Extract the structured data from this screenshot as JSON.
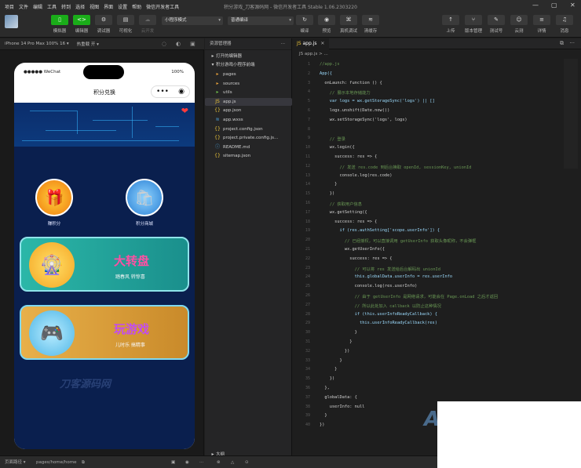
{
  "menubar": {
    "items": [
      "项目",
      "文件",
      "编辑",
      "工具",
      "转到",
      "选择",
      "视图",
      "界面",
      "设置",
      "帮助",
      "微信开发者工具"
    ],
    "title": "积分游戏_刀客源码网 - 微信开发者工具 Stable 1.06.2303220"
  },
  "toolbar": {
    "left_buttons": [
      {
        "label": "模拟器",
        "icon": "phone-icon",
        "glyph": "▯"
      },
      {
        "label": "编辑器",
        "icon": "code-icon",
        "glyph": "<>"
      },
      {
        "label": "调试器",
        "icon": "debug-icon",
        "glyph": "⚙"
      },
      {
        "label": "可视化",
        "icon": "visual-icon",
        "glyph": "▤"
      },
      {
        "label": "云开发",
        "icon": "cloud-icon",
        "glyph": "☁"
      }
    ],
    "mode_select": "小程序模式",
    "compile_select": "普通编译",
    "mid_buttons": [
      {
        "label": "编译",
        "icon": "refresh-icon",
        "glyph": "↻"
      },
      {
        "label": "预览",
        "icon": "eye-icon",
        "glyph": "◉"
      },
      {
        "label": "真机调试",
        "icon": "device-debug-icon",
        "glyph": "⌘"
      },
      {
        "label": "清缓存",
        "icon": "layers-icon",
        "glyph": "≋"
      }
    ],
    "right_buttons": [
      {
        "label": "上传",
        "icon": "upload-icon",
        "glyph": "↑"
      },
      {
        "label": "版本管理",
        "icon": "version-icon",
        "glyph": "⑂"
      },
      {
        "label": "测试号",
        "icon": "test-icon",
        "glyph": "✎"
      },
      {
        "label": "云测",
        "icon": "cloudtest-icon",
        "glyph": "☺"
      },
      {
        "label": "详情",
        "icon": "details-icon",
        "glyph": "≡"
      },
      {
        "label": "消息",
        "icon": "bell-icon",
        "glyph": "♫"
      }
    ]
  },
  "simulator": {
    "device": "iPhone 14 Pro Max 100% 16 ▾",
    "hotreload": "热重载 开 ▾",
    "status_left": "●●●●● WeChat",
    "status_right": "100%",
    "nav_title": "积分兑换",
    "icons": [
      {
        "label": "赚积分"
      },
      {
        "label": "积分商城"
      }
    ],
    "card1": {
      "title": "大转盘",
      "subtitle": "踏春风  转惊喜"
    },
    "card2": {
      "title": "玩游戏",
      "subtitle": "儿时乐  搞精事"
    },
    "watermark": "刀客源码网"
  },
  "explorer": {
    "header": "资源管理器",
    "sections": [
      "打开的编辑器",
      "积分游戏小程序前端"
    ],
    "files": [
      {
        "name": "pages",
        "glyph": "▸",
        "color": "#e8a13a",
        "indent": 1
      },
      {
        "name": "sources",
        "glyph": "▸",
        "color": "#e8a13a",
        "indent": 1
      },
      {
        "name": "utils",
        "glyph": "▸",
        "color": "#6fbf4b",
        "indent": 1
      },
      {
        "name": "app.js",
        "glyph": "JS",
        "color": "#e8c23a",
        "indent": 1,
        "selected": true
      },
      {
        "name": "app.json",
        "glyph": "{}",
        "color": "#e8c23a",
        "indent": 1
      },
      {
        "name": "app.wxss",
        "glyph": "≋",
        "color": "#4aa3df",
        "indent": 1
      },
      {
        "name": "project.config.json",
        "glyph": "{}",
        "color": "#e8c23a",
        "indent": 1
      },
      {
        "name": "project.private.config.js...",
        "glyph": "{}",
        "color": "#e8c23a",
        "indent": 1
      },
      {
        "name": "README.md",
        "glyph": "ⓘ",
        "color": "#4aa3df",
        "indent": 1
      },
      {
        "name": "sitemap.json",
        "glyph": "{}",
        "color": "#e8c23a",
        "indent": 1
      }
    ],
    "outline": "大纲"
  },
  "editor": {
    "tab": "app.js",
    "breadcrumb": "JS app.js > ...",
    "lines": [
      "//app.js",
      "App({",
      "  onLaunch: function () {",
      "    // 展示本地存储能力",
      "    var logs = wx.getStorageSync('logs') || []",
      "    logs.unshift(Date.now())",
      "    wx.setStorageSync('logs', logs)",
      "",
      "    // 登录",
      "    wx.login({",
      "      success: res => {",
      "        // 发送 res.code 到后台换取 openId, sessionKey, unionId",
      "        console.log(res.code)",
      "      }",
      "    })",
      "    // 获取用户信息",
      "    wx.getSetting({",
      "      success: res => {",
      "        if (res.authSetting['scope.userInfo']) {",
      "          // 已经授权，可以直接调用 getUserInfo 获取头像昵称，不会弹框",
      "          wx.getUserInfo({",
      "            success: res => {",
      "              // 可以将 res 发送给后台解码出 unionId",
      "              this.globalData.userInfo = res.userInfo",
      "              console.log(res.userInfo)",
      "              // 由于 getUserInfo 是网络请求，可能会在 Page.onLoad 之后才返回",
      "              // 所以此处加入 callback 以防止这种情况",
      "              if (this.userInfoReadyCallback) {",
      "                this.userInfoReadyCallback(res)",
      "              }",
      "            }",
      "          })",
      "        }",
      "      }",
      "    })",
      "  },",
      "  globalData: {",
      "    userInfo: null",
      "  }",
      "})"
    ]
  },
  "statusbar": {
    "path_label": "页面路径 ▾",
    "path": "pages/home/home",
    "copy_icon": "⧉"
  },
  "colors": {
    "accent_green": "#1aad19",
    "code_keyword": "#569cd6",
    "code_string": "#ce9178",
    "code_comment": "#6a9955",
    "phone_bg": "#0a1f4e"
  }
}
